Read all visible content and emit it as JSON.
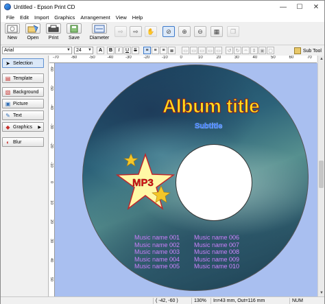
{
  "window": {
    "title": "Untitled - Epson Print CD",
    "minimize": "—",
    "maximize": "☐",
    "close": "✕"
  },
  "menu": [
    "File",
    "Edit",
    "Import",
    "Graphics",
    "Arrangement",
    "View",
    "Help"
  ],
  "toolbar": {
    "new_label": "New",
    "open_label": "Open",
    "print_label": "Print",
    "save_label": "Save",
    "diameter_label": "Diameter"
  },
  "format": {
    "font": "Arial",
    "size": "24",
    "subtool_label": "Sub Tool"
  },
  "sidebar": {
    "items": [
      {
        "label": "Selection",
        "icon": "arrow-icon"
      },
      {
        "label": "Template",
        "icon": "template-icon"
      },
      {
        "label": "Background",
        "icon": "background-icon"
      },
      {
        "label": "Picture",
        "icon": "picture-icon"
      },
      {
        "label": "Text",
        "icon": "text-icon"
      },
      {
        "label": "Graphics",
        "icon": "graphics-icon"
      },
      {
        "label": "Blur",
        "icon": "blur-icon"
      }
    ]
  },
  "ruler": {
    "top": [
      "-70",
      "-60",
      "-50",
      "-40",
      "-30",
      "-20",
      "-10",
      "0",
      "10",
      "20",
      "30",
      "40",
      "50",
      "60",
      "70"
    ],
    "left": [
      "-60",
      "-50",
      "-40",
      "-30",
      "-20",
      "-10",
      "0",
      "10",
      "20",
      "30",
      "40",
      "50"
    ]
  },
  "design": {
    "album_title": "Album title",
    "subtitle": "Subtitle",
    "badge": "MP3",
    "tracks_left": [
      "Music name 001",
      "Music name 002",
      "Music name 003",
      "Music name 004",
      "Music name 005"
    ],
    "tracks_right": [
      "Music name 006",
      "Music name 007",
      "Music name 008",
      "Music name 009",
      "Music name 010"
    ]
  },
  "colors": {
    "canvas_bg": "#a9bff0",
    "title_fill": "#ffdf1c",
    "subtitle_fill": "#2d69ff",
    "track_text": "#d4a6ff",
    "star_fill": "#fff8a6",
    "star_border": "#c0262b"
  },
  "status": {
    "coords": "( -42, -60 )",
    "zoom": "130%",
    "diameter": "In=43 mm, Out=116 mm",
    "numlock": "NUM"
  }
}
